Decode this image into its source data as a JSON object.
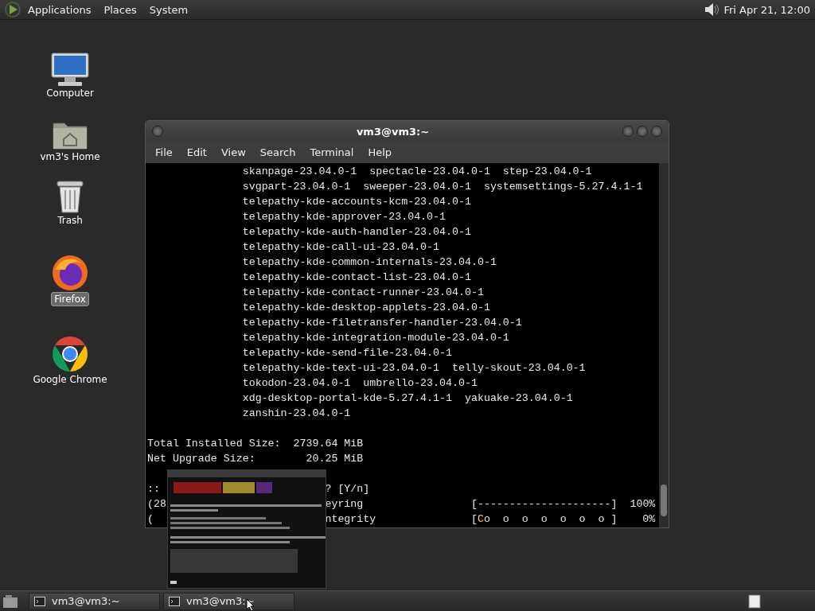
{
  "top_panel": {
    "menus": [
      "Applications",
      "Places",
      "System"
    ],
    "clock": "Fri Apr 21, 12:00"
  },
  "desktop_icons": [
    {
      "label": "Computer",
      "kind": "computer",
      "selected": false
    },
    {
      "label": "vm3's Home",
      "kind": "home",
      "selected": false
    },
    {
      "label": "Trash",
      "kind": "trash",
      "selected": false
    },
    {
      "label": "Firefox",
      "kind": "firefox",
      "selected": true
    },
    {
      "label": "Google Chrome",
      "kind": "chrome",
      "selected": false
    }
  ],
  "window": {
    "title": "vm3@vm3:~",
    "menu": [
      "File",
      "Edit",
      "View",
      "Search",
      "Terminal",
      "Help"
    ]
  },
  "terminal": {
    "lines": [
      {
        "kind": "package",
        "text": "skanpage-23.04.0-1  spectacle-23.04.0-1  step-23.04.0-1"
      },
      {
        "kind": "package",
        "text": "svgpart-23.04.0-1  sweeper-23.04.0-1  systemsettings-5.27.4.1-1"
      },
      {
        "kind": "package",
        "text": "telepathy-kde-accounts-kcm-23.04.0-1"
      },
      {
        "kind": "package",
        "text": "telepathy-kde-approver-23.04.0-1"
      },
      {
        "kind": "package",
        "text": "telepathy-kde-auth-handler-23.04.0-1"
      },
      {
        "kind": "package",
        "text": "telepathy-kde-call-ui-23.04.0-1"
      },
      {
        "kind": "package",
        "text": "telepathy-kde-common-internals-23.04.0-1"
      },
      {
        "kind": "package",
        "text": "telepathy-kde-contact-list-23.04.0-1"
      },
      {
        "kind": "package",
        "text": "telepathy-kde-contact-runner-23.04.0-1"
      },
      {
        "kind": "package",
        "text": "telepathy-kde-desktop-applets-23.04.0-1"
      },
      {
        "kind": "package",
        "text": "telepathy-kde-filetransfer-handler-23.04.0-1"
      },
      {
        "kind": "package",
        "text": "telepathy-kde-integration-module-23.04.0-1"
      },
      {
        "kind": "package",
        "text": "telepathy-kde-send-file-23.04.0-1"
      },
      {
        "kind": "package",
        "text": "telepathy-kde-text-ui-23.04.0-1  telly-skout-23.04.0-1"
      },
      {
        "kind": "package",
        "text": "tokodon-23.04.0-1  umbrello-23.04.0-1"
      },
      {
        "kind": "package",
        "text": "xdg-desktop-portal-kde-5.27.4.1-1  yakuake-23.04.0-1"
      },
      {
        "kind": "package",
        "text": "zanshin-23.04.0-1"
      },
      {
        "kind": "blank"
      },
      {
        "kind": "plain",
        "text": "Total Installed Size:  2739.64 MiB"
      },
      {
        "kind": "plain",
        "text": "Net Upgrade Size:        20.25 MiB"
      },
      {
        "kind": "blank"
      },
      {
        "kind": "split",
        "left": "::",
        "middle": "? [Y/n]"
      },
      {
        "kind": "progress",
        "left": "(28",
        "middle": "eyring",
        "bar": "[---------------------]",
        "percent": "100%"
      },
      {
        "kind": "progress",
        "left": "(",
        "middle": "ntegrity",
        "bar_head": "[",
        "pacman": "C",
        "bar": "o  o  o  o  o  o  o ]",
        "percent": "0%"
      }
    ]
  },
  "taskbar": {
    "tasks": [
      {
        "label": "vm3@vm3:~"
      },
      {
        "label": "vm3@vm3:~"
      }
    ]
  }
}
